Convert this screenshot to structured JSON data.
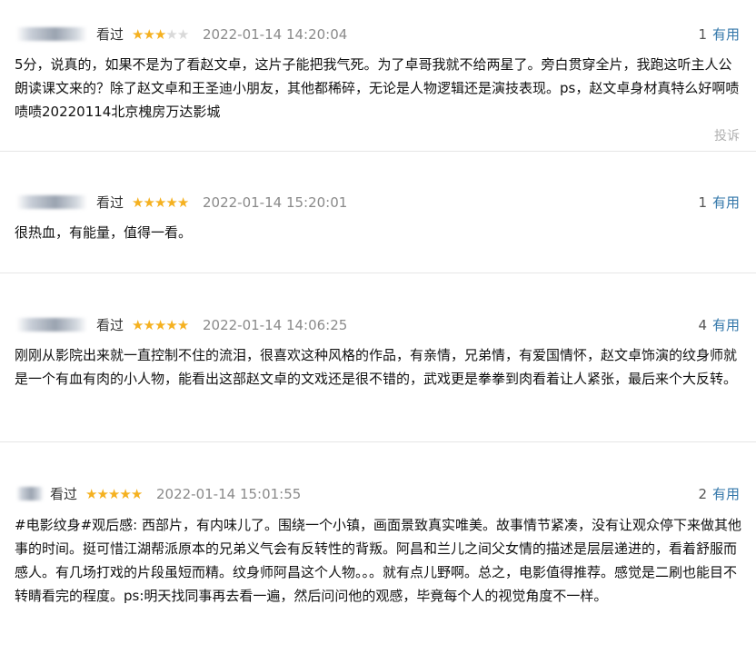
{
  "reviews": [
    {
      "watched": "看过",
      "rating": 3,
      "time": "2022-01-14 14:20:04",
      "useful_count": "1",
      "useful_label": "有用",
      "text": "5分，说真的，如果不是为了看赵文卓，这片子能把我气死。为了卓哥我就不给两星了。旁白贯穿全片，我跑这听主人公朗读课文来的？除了赵文卓和王圣迪小朋友，其他都稀碎，无论是人物逻辑还是演技表现。ps，赵文卓身材真特么好啊啧啧啧20220114北京槐房万达影城",
      "report_label": "投诉"
    },
    {
      "watched": "看过",
      "rating": 5,
      "time": "2022-01-14 15:20:01",
      "useful_count": "1",
      "useful_label": "有用",
      "text": "很热血，有能量，值得一看。"
    },
    {
      "watched": "看过",
      "rating": 5,
      "time": "2022-01-14 14:06:25",
      "useful_count": "4",
      "useful_label": "有用",
      "text": "刚刚从影院出来就一直控制不住的流泪，很喜欢这种风格的作品，有亲情，兄弟情，有爱国情怀，赵文卓饰演的纹身师就是一个有血有肉的小人物，能看出这部赵文卓的文戏还是很不错的，武戏更是拳拳到肉看着让人紧张，最后来个大反转。"
    },
    {
      "watched": "看过",
      "rating": 5,
      "time": "2022-01-14 15:01:55",
      "useful_count": "2",
      "useful_label": "有用",
      "text": "#电影纹身#观后感: 西部片，有内味儿了。围绕一个小镇，画面景致真实唯美。故事情节紧凑，没有让观众停下来做其他事的时间。挺可惜江湖帮派原本的兄弟义气会有反转性的背叛。阿昌和兰儿之间父女情的描述是层层递进的，看着舒服而感人。有几场打戏的片段虽短而精。纹身师阿昌这个人物。。。就有点儿野啊。总之，电影值得推荐。感觉是二刷也能目不转睛看完的程度。ps:明天找同事再去看一遍，然后问问他的观感，毕竟每个人的视觉角度不一样。"
    }
  ],
  "colors": {
    "star_on": "#f5b120",
    "star_off": "#d9d9d9",
    "link": "#3377aa",
    "time": "#8a8a8a"
  }
}
